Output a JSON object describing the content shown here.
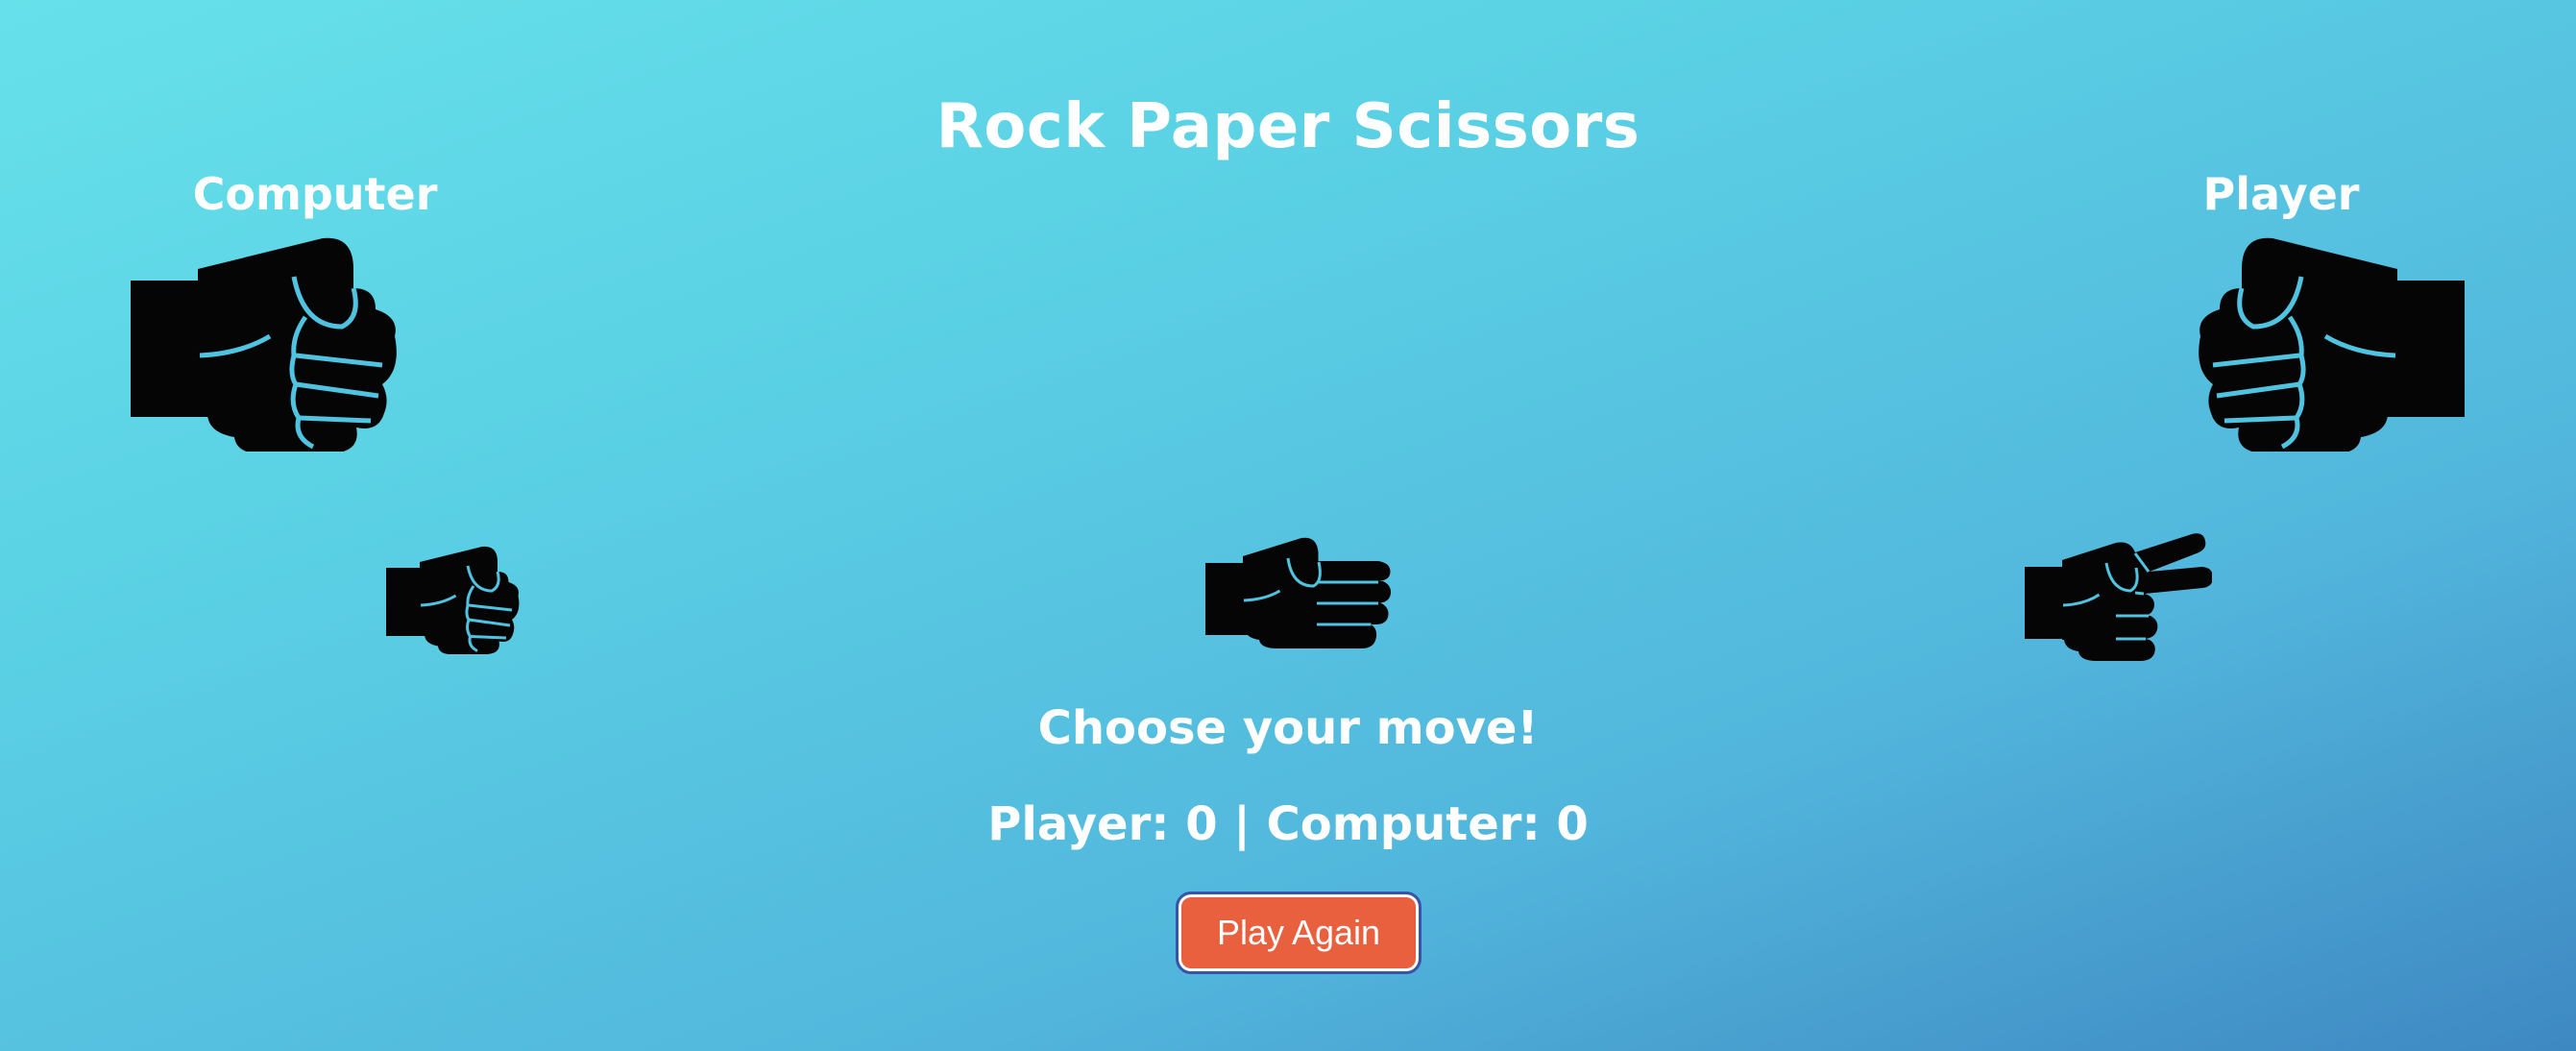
{
  "game": {
    "title": "Rock Paper Scissors",
    "computer_label": "Computer",
    "player_label": "Player",
    "computer_choice_icon": "rock-fist",
    "player_choice_icon": "rock-fist",
    "choices": [
      {
        "name": "rock",
        "icon": "rock-fist"
      },
      {
        "name": "paper",
        "icon": "paper-hand"
      },
      {
        "name": "scissors",
        "icon": "scissors-hand"
      }
    ],
    "message": "Choose your move!",
    "score_text": "Player: 0 | Computer: 0",
    "play_again_label": "Play Again"
  },
  "colors": {
    "background_top": "#66e1ea",
    "background_bottom": "#3e88c2",
    "icon": "#050505",
    "icon_outline": "#4fc3e0",
    "button": "#e9603f",
    "button_border": "#3654a8",
    "text": "#ffffff"
  }
}
